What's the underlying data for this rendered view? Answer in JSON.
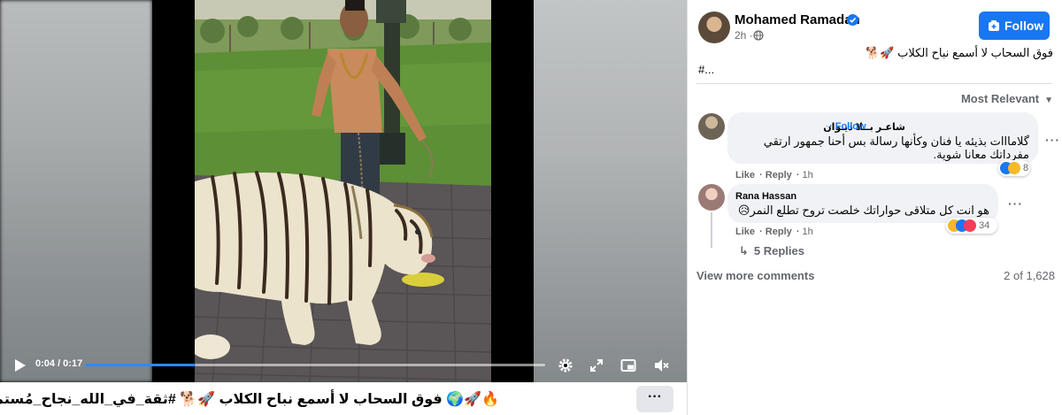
{
  "video": {
    "time_display": "0:04 / 0:17",
    "progress_fraction": 0.24
  },
  "caption": {
    "text": "🔥🚀🌍 فوق السحاب لا أسمع نباح الكلاب 🚀🐕 #ثقة_في_الله_نجاح_مُستمر",
    "more_label": "···"
  },
  "post": {
    "author": "Mohamed Ramadan",
    "time": "2h ·",
    "follow_label": "Follow",
    "text": "فوق السحاب لا أسمع نباح الكلاب 🚀🐕",
    "hashtag_more": "#..."
  },
  "comments_header": {
    "sort_label": "Most Relevant"
  },
  "comments": [
    {
      "author": "شاعـر بــلا ديـوان",
      "follow_label": "· Follow",
      "line1": "گلامااات بذيئه يا فنان وكأنها رسالة بس أحنا جمهور ارتقي",
      "line2": "مفرداتك معانا شوية.",
      "like_label": "Like",
      "reply_label": "Reply",
      "time": "1h",
      "reaction_count": "8"
    },
    {
      "author": "Rana Hassan",
      "line1": "هو انت كل متلاقى حواراتك خلصت تروح تطلع النمر😥",
      "like_label": "Like",
      "reply_label": "Reply",
      "time": "1h",
      "reaction_count": "34"
    }
  ],
  "replies_label": "5 Replies",
  "view_more_label": "View more comments",
  "comment_count_label": "2 of 1,628",
  "colors": {
    "accent": "#1877f2",
    "progress": "#2d88ff",
    "secondary_text": "#65676b",
    "bubble": "#f0f2f5"
  }
}
